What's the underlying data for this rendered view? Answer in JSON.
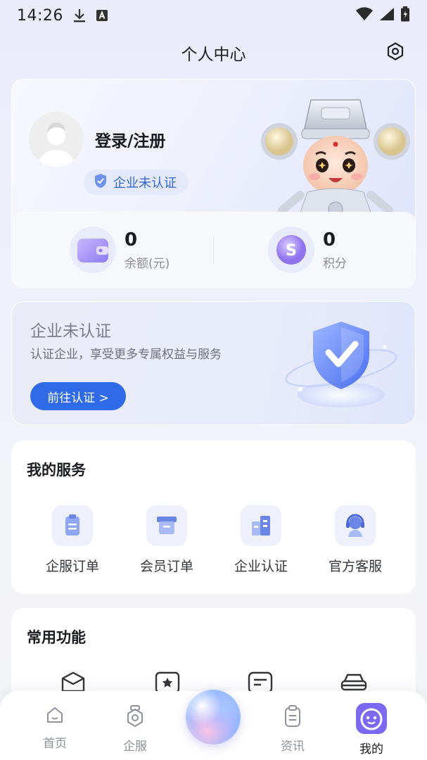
{
  "status_bar": {
    "time": "14:26"
  },
  "header": {
    "title": "个人中心"
  },
  "profile": {
    "login_label": "登录/注册",
    "cert_badge": "企业未认证",
    "balance": {
      "value": "0",
      "label": "余额(元)"
    },
    "points": {
      "value": "0",
      "label": "积分"
    }
  },
  "cert_card": {
    "title": "企业未认证",
    "subtitle": "认证企业，享受更多专属权益与服务",
    "button": "前往认证 >"
  },
  "services": {
    "title": "我的服务",
    "items": [
      {
        "label": "企服订单",
        "icon": "order-icon"
      },
      {
        "label": "会员订单",
        "icon": "member-order-icon"
      },
      {
        "label": "企业认证",
        "icon": "enterprise-cert-icon"
      },
      {
        "label": "官方客服",
        "icon": "customer-service-icon"
      }
    ]
  },
  "common": {
    "title": "常用功能",
    "items": [
      {
        "icon": "box-icon"
      },
      {
        "icon": "star-card-icon"
      },
      {
        "icon": "message-icon"
      },
      {
        "icon": "car-icon"
      }
    ]
  },
  "tab_bar": {
    "items": [
      {
        "label": "首页",
        "icon": "home-icon"
      },
      {
        "label": "企服",
        "icon": "service-icon"
      },
      {
        "label": "资讯",
        "icon": "news-icon"
      },
      {
        "label": "我的",
        "icon": "mine-icon"
      }
    ],
    "active": "我的"
  },
  "colors": {
    "accent": "#2f6ae8",
    "active_tab": "#7b68f5"
  }
}
